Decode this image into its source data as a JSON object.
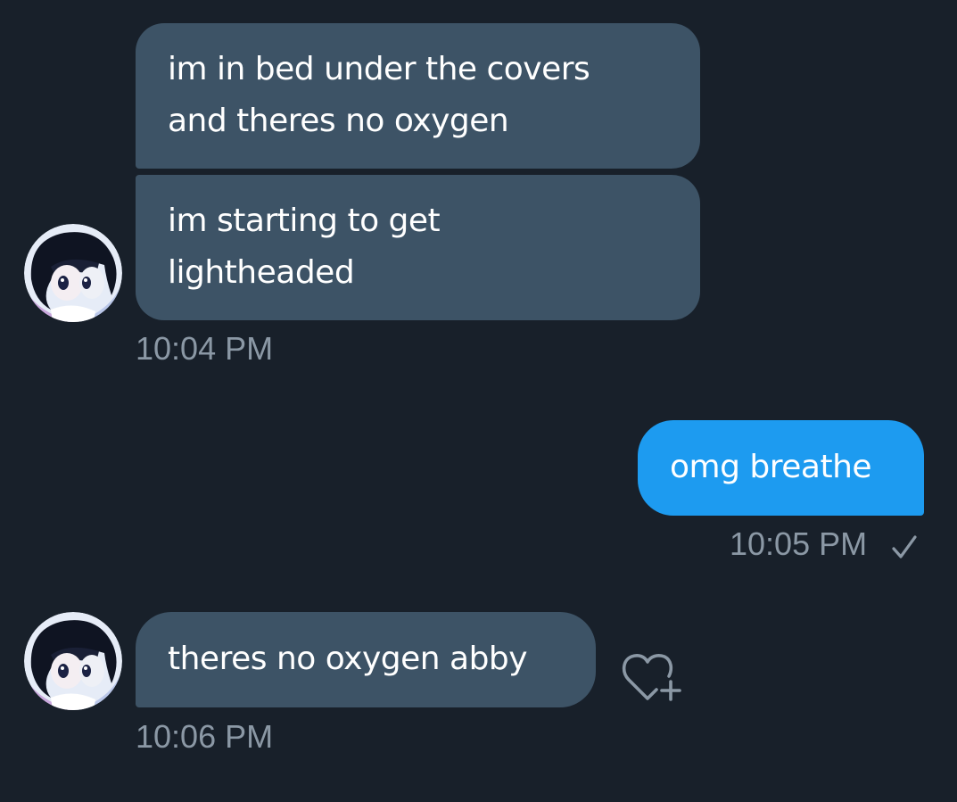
{
  "conversation": {
    "messages": [
      {
        "text": "im in bed under the covers and theres no oxygen",
        "line1": "im in bed under the covers",
        "line2": "and theres no oxygen"
      },
      {
        "text": "im starting to get lightheaded",
        "line1": "im starting to get",
        "line2": "lightheaded"
      },
      {
        "time": "10:04 PM"
      },
      {
        "text": "omg breathe"
      },
      {
        "time": "10:05 PM",
        "status_icon": "checkmark-icon"
      },
      {
        "text": "theres no oxygen abby"
      },
      {
        "time": "10:06 PM",
        "reaction_icon": "heart-plus-icon"
      }
    ]
  },
  "colors": {
    "background": "#18202a",
    "received_bubble": "#3d5366",
    "sent_bubble": "#1d9bf0",
    "timestamp": "#8b98a5"
  }
}
